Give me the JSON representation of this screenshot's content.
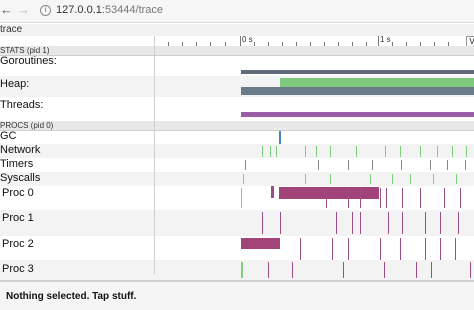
{
  "browser": {
    "url_host": "127.0.0.1",
    "url_rest": ":53444/trace",
    "back_icon": "left-arrow",
    "forward_icon": "right-arrow",
    "info_icon": "info"
  },
  "trace": {
    "title": "trace",
    "ruler": {
      "label_0": "0 s",
      "label_1": "1 s"
    },
    "view_options_label": "V"
  },
  "sections": {
    "stats": "STATS (pid 1)",
    "procs": "PROCS (pid 0)"
  },
  "rows": {
    "goroutines": "Goroutines:",
    "heap": "Heap:",
    "threads": "Threads:",
    "gc": "GC",
    "network": "Network",
    "timers": "Timers",
    "syscalls": "Syscalls",
    "proc0": "Proc 0",
    "proc1": "Proc 1",
    "proc2": "Proc 2",
    "proc3": "Proc 3"
  },
  "status": {
    "text": "Nothing selected. Tap stuff."
  },
  "colors": {
    "goroutines": "#5f6a7a",
    "heap_allocated": "#7fc97f",
    "heap_next_gc": "#6a7b8a",
    "threads": "#9b5fa8",
    "gc_event": "#4a7fc0",
    "event_green": "#7ed17e",
    "event_purple": "#9c4f86",
    "event_magenta": "#a2447a",
    "event_grey": "#888888"
  }
}
